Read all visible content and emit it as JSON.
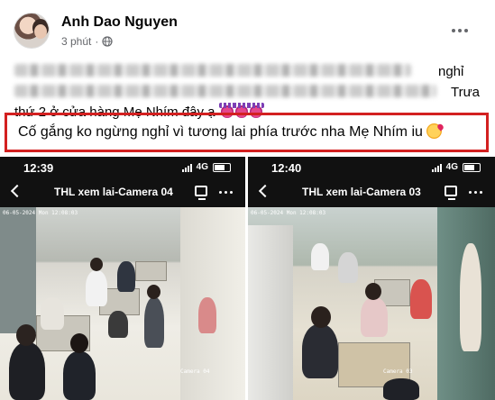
{
  "post": {
    "author": "Anh Dao Nguyen",
    "time": "3 phút",
    "separator": "·",
    "visible_text_fragments": [
      "nghỉ",
      "Trưa",
      "thứ 2 ở cửa hàng Mẹ Nhím đây ạ"
    ],
    "highlighted_text": "Cố gắng ko ngừng nghỉ vì tương lai phía trước nha Mẹ Nhím iu",
    "highlight_border_color": "#d32020"
  },
  "screenshots": [
    {
      "time": "12:39",
      "network": "4G",
      "title": "THL xem lai-Camera 04",
      "camera_label": "Camera 04"
    },
    {
      "time": "12:40",
      "network": "4G",
      "title": "THL xem lai-Camera 03",
      "camera_label": "Camera 03"
    }
  ],
  "icons": {
    "avatar": "avatar",
    "globe": "globe-icon",
    "more": "more-icon",
    "back": "back-arrow-icon",
    "cast": "screen-cast-icon"
  }
}
